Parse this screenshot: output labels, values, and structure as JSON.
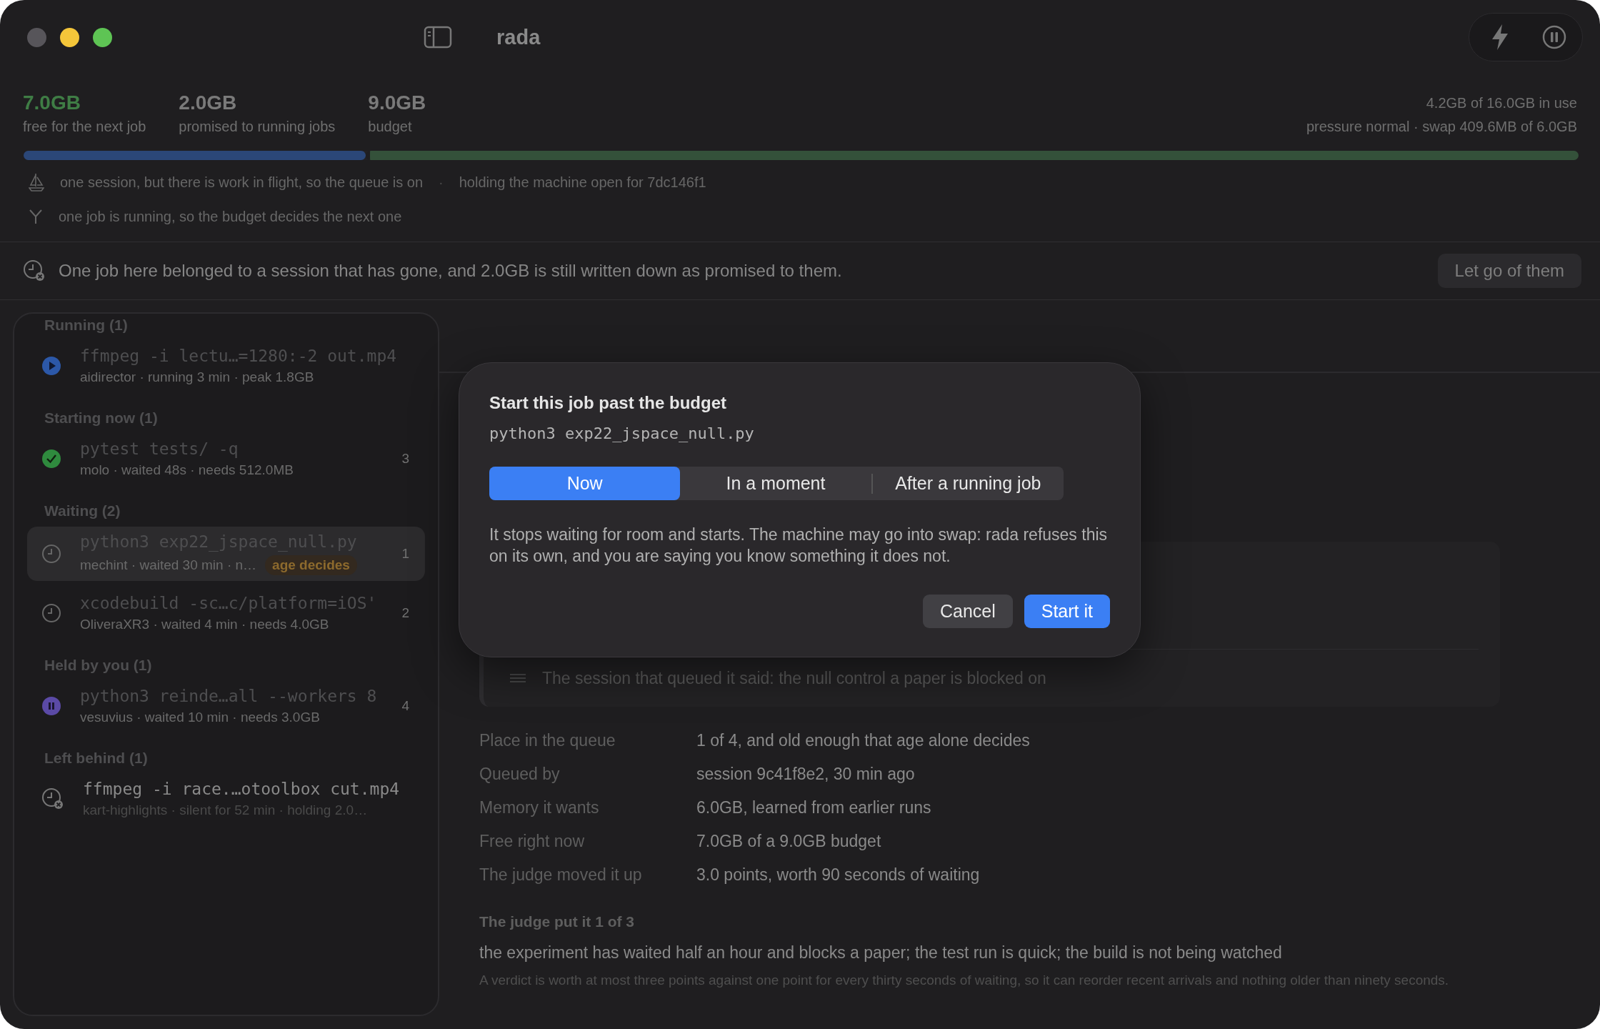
{
  "window": {
    "title": "rada"
  },
  "stats": [
    {
      "value": "7.0GB",
      "label": "free for the next job",
      "kind": "free"
    },
    {
      "value": "2.0GB",
      "label": "promised to running jobs",
      "kind": "plain"
    },
    {
      "value": "9.0GB",
      "label": "budget",
      "kind": "plain"
    }
  ],
  "machine": {
    "usage": "4.2GB of 16.0GB in use",
    "pressure": "pressure normal · swap 409.6MB of 6.0GB"
  },
  "budget_bar": [
    {
      "kind": "promised",
      "level": 0.22,
      "color": "#2b4778"
    },
    {
      "kind": "free",
      "level": 0.78,
      "color": "#34513a"
    }
  ],
  "notes": [
    {
      "kind": "boat",
      "separator": "·",
      "parts": [
        "one session, but there is work in flight, so the queue is on",
        "holding the machine open for 7dc146f1"
      ]
    },
    {
      "kind": "fork",
      "parts": [
        "one job is running, so the budget decides the next one"
      ]
    }
  ],
  "alert": {
    "text": "One job here belonged to a session that has gone, and 2.0GB is still written down as promised to them.",
    "button": "Let go of them"
  },
  "queue": [
    {
      "title": "Running (1)",
      "items": [
        {
          "kind": "running",
          "command": "ffmpeg -i lectu…=1280:-2 out.mp4",
          "meta": "aidirector · running 3 min · peak 1.8GB",
          "selected": false
        }
      ]
    },
    {
      "title": "Starting now (1)",
      "items": [
        {
          "kind": "starting",
          "command": "pytest tests/ -q",
          "meta": "molo · waited 48s · needs 512.0MB",
          "rank": "3",
          "selected": false
        }
      ]
    },
    {
      "title": "Waiting (2)",
      "items": [
        {
          "kind": "waiting",
          "command": "python3 exp22_jspace_null.py",
          "meta": "mechint · waited 30 min · n…",
          "badge": "age decides",
          "rank": "1",
          "selected": true
        },
        {
          "kind": "waiting",
          "command": "xcodebuild -sc…c/platform=iOS'",
          "meta": "OliveraXR3 · waited 4 min · needs 4.0GB",
          "rank": "2",
          "selected": false
        }
      ]
    },
    {
      "title": "Held by you (1)",
      "items": [
        {
          "kind": "held",
          "command": "python3 reinde…all --workers 8",
          "meta": "vesuvius · waited 10 min · needs 3.0GB",
          "rank": "4",
          "selected": false
        }
      ]
    },
    {
      "title": "Left behind (1)",
      "items": [
        {
          "kind": "left",
          "command": "ffmpeg -i race.…otoolbox cut.mp4",
          "meta": "kart-highlights · silent for 52 min · holding 2.0…",
          "selected": false
        }
      ]
    }
  ],
  "detail": {
    "session_note": "The session that queued it said: the null control a paper is blocked on",
    "facts": [
      {
        "label": "Place in the queue",
        "value": "1 of 4, and old enough that age alone decides"
      },
      {
        "label": "Queued by",
        "value": "session 9c41f8e2, 30 min ago"
      },
      {
        "label": "Memory it wants",
        "value": "6.0GB, learned from earlier runs"
      },
      {
        "label": "Free right now",
        "value": "7.0GB of a 9.0GB budget"
      },
      {
        "label": "The judge moved it up",
        "value": "3.0 points, worth 90 seconds of waiting"
      }
    ],
    "judge": {
      "heading": "The judge put it 1 of 3",
      "verdict": "the experiment has waited half an hour and blocks a paper; the test run is quick; the build is not being watched",
      "footnote": "A verdict is worth at most three points against one point for every thirty seconds of waiting, so it can reorder recent arrivals and nothing older than ninety seconds."
    }
  },
  "dialog": {
    "title": "Start this job past the budget",
    "command": "python3 exp22_jspace_null.py",
    "options": [
      {
        "label": "Now",
        "selected": true
      },
      {
        "label": "In a moment",
        "selected": false
      },
      {
        "label": "After a running job",
        "selected": false
      }
    ],
    "description": "It stops waiting for room and starts. The machine may go into swap: rada refuses this on its own, and you are saying you know something it does not.",
    "buttons": [
      {
        "label": "Cancel",
        "kind": "secondary"
      },
      {
        "label": "Start it",
        "kind": "primary"
      }
    ]
  }
}
